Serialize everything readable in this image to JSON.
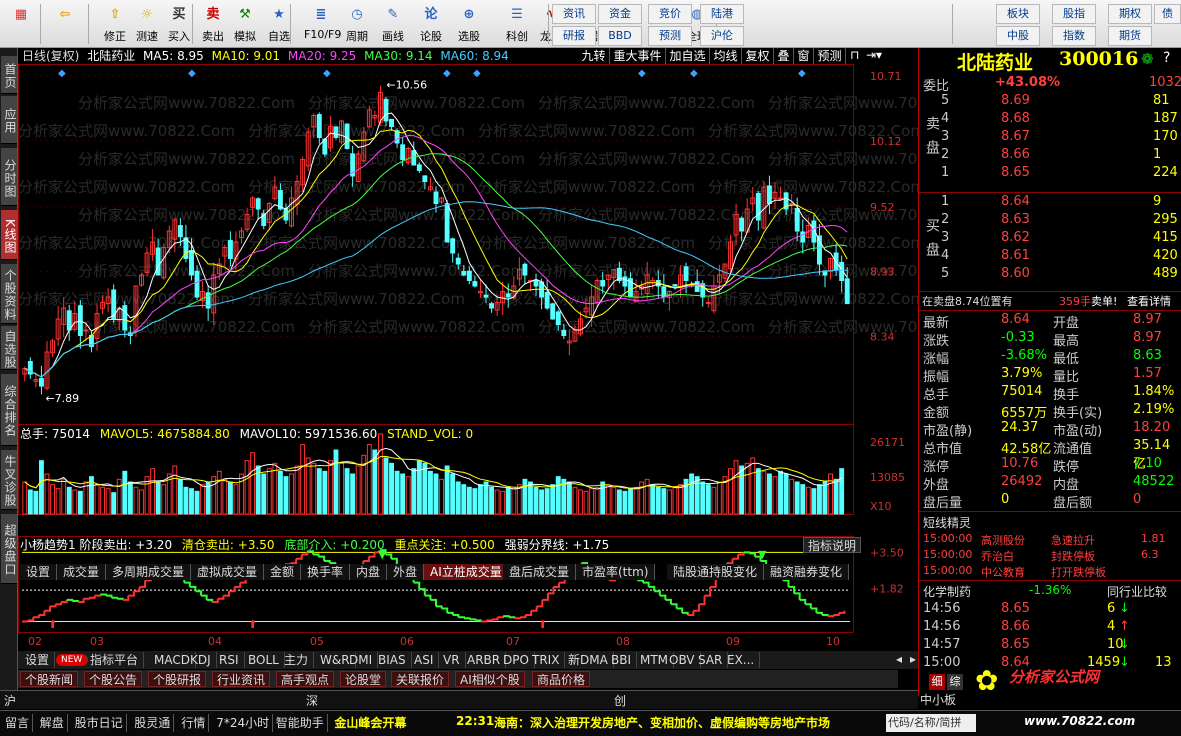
{
  "toolbar": {
    "buttons": [
      {
        "label": "",
        "icon": "grid-icon"
      },
      {
        "label": "",
        "icon": "back-arrow-icon"
      },
      {
        "label": "修正"
      },
      {
        "label": "测速"
      },
      {
        "label": "买入"
      },
      {
        "label": "卖出"
      },
      {
        "label": "模拟"
      },
      {
        "label": "自选"
      },
      {
        "label": "F10/F9"
      },
      {
        "label": "周期"
      },
      {
        "label": "画线"
      },
      {
        "label": "论股"
      },
      {
        "label": "选股"
      },
      {
        "label": "科创"
      },
      {
        "label": "龙虎"
      },
      {
        "label": "数据"
      },
      {
        "label": "热点"
      },
      {
        "label": "新闻"
      },
      {
        "label": "全球"
      }
    ],
    "small": [
      "资讯",
      "资金",
      "竞价",
      "陆港",
      "研报",
      "BBD",
      "预测",
      "沪伦",
      "板块",
      "股指",
      "期权",
      "债",
      "中股",
      "指数",
      "期货"
    ],
    "glyph_buy": "买",
    "glyph_sell": "卖",
    "glyph_clock": "⏰",
    "glyph_lun": "论",
    "glyph_pe": "PE",
    "glyph_hot": "🔥"
  },
  "sidebar": [
    "首页",
    "应用",
    "分时图",
    "K线图",
    "个股资料",
    "自选股",
    "综合排名",
    "牛叉诊股",
    "超级盘口"
  ],
  "chart": {
    "header": {
      "period": "日线(复权)",
      "name": "北陆药业",
      "ma5": "MA5: 8.95",
      "ma10": "MA10: 9.01",
      "ma20": "MA20: 9.25",
      "ma30": "MA30: 9.14",
      "ma60": "MA60: 8.94"
    },
    "topbtns": [
      "九转",
      "重大事件",
      "加自选",
      "均线",
      "复权",
      "叠",
      "窗",
      "预测"
    ],
    "price_ticks": [
      "10.71",
      "10.12",
      "9.52",
      "8.93",
      "8.34"
    ],
    "high_label": "10.56",
    "low_label": "7.89",
    "watermark": "分析家公式网www.70822.Com",
    "vol_header": {
      "total": "总手: 75014",
      "mavol5": "MAVOL5: 4675884.80",
      "mavol10": "MAVOL10: 5971536.60",
      "std": "STAND_VOL: 0"
    },
    "vol_ticks": [
      "26171",
      "13085",
      "X10"
    ],
    "vtabs": [
      "设置",
      "成交量",
      "多周期成交量",
      "虚拟成交量",
      "金额",
      "换手率",
      "内盘",
      "外盘",
      "AI立桩成交量",
      "盘后成交量",
      "市盈率(ttm)",
      "陆股通持股变化",
      "融资融券变化"
    ],
    "ind_header": {
      "t1": "小杨趋势1 阶段卖出: +3.20",
      "t2": "清仓卖出: +3.50",
      "t3": "底部介入: +0.200",
      "t4": "重点关注: +0.500",
      "t5": "强弱分界线: +1.75",
      "help": "指标说明"
    },
    "ind_ticks": [
      "+3.50",
      "+1.82"
    ],
    "months": [
      "02",
      "03",
      "04",
      "05",
      "06",
      "07",
      "08",
      "09",
      "10"
    ],
    "candles": {
      "closes": [
        8.05,
        8.0,
        7.95,
        7.89,
        8.2,
        8.3,
        8.5,
        8.6,
        8.4,
        8.55,
        8.35,
        8.4,
        8.25,
        8.55,
        8.65,
        8.7,
        8.5,
        8.6,
        8.4,
        8.35,
        8.8,
        8.9,
        9.1,
        9.2,
        8.9,
        9.15,
        9.3,
        9.4,
        9.25,
        9.05,
        8.9,
        8.7,
        8.75,
        8.6,
        8.9,
        9.0,
        9.15,
        9.05,
        9.2,
        9.3,
        9.45,
        9.6,
        9.5,
        9.35,
        9.55,
        9.7,
        9.5,
        9.4,
        9.6,
        9.75,
        9.95,
        10.2,
        10.35,
        10.15,
        10.0,
        10.25,
        10.15,
        10.3,
        10.05,
        9.8,
        10.0,
        10.2,
        10.4,
        10.35,
        10.56,
        10.3,
        10.25,
        10.1,
        9.95,
        10.05,
        9.9,
        9.85,
        9.75,
        9.7,
        9.55,
        9.6,
        9.2,
        9.1,
        9.0,
        8.9,
        8.85,
        8.8,
        8.75,
        8.7,
        8.6,
        8.65,
        8.75,
        8.7,
        8.8,
        8.95,
        8.9,
        8.85,
        8.8,
        8.7,
        8.6,
        8.5,
        8.45,
        8.35,
        8.3,
        8.4,
        8.5,
        8.6,
        8.7,
        8.85,
        8.8,
        8.9,
        8.95,
        8.85,
        8.8,
        8.7,
        8.75,
        8.8,
        8.9,
        8.85,
        8.8,
        8.7,
        8.75,
        8.8,
        8.9,
        8.85,
        8.8,
        8.75,
        8.7,
        8.65,
        8.8,
        8.9,
        9.0,
        9.2,
        9.45,
        9.3,
        9.5,
        9.6,
        9.4,
        9.7,
        9.55,
        9.65,
        9.6,
        9.5,
        9.55,
        9.3,
        9.2,
        9.35,
        9.2,
        9.0,
        8.9,
        9.05,
        8.95,
        8.85,
        8.64
      ],
      "range": [
        7.6,
        10.8
      ]
    },
    "volumes": [
      120,
      90,
      85,
      200,
      150,
      110,
      95,
      130,
      100,
      90,
      85,
      120,
      140,
      110,
      100,
      95,
      80,
      130,
      160,
      120,
      100,
      90,
      140,
      170,
      120,
      110,
      150,
      180,
      130,
      100,
      95,
      85,
      110,
      120,
      140,
      160,
      130,
      120,
      110,
      150,
      200,
      230,
      180,
      150,
      170,
      190,
      160,
      140,
      150,
      180,
      260,
      210,
      190,
      170,
      160,
      200,
      240,
      190,
      170,
      150,
      180,
      220,
      260,
      240,
      300,
      210,
      190,
      160,
      150,
      140,
      170,
      200,
      190,
      160,
      150,
      130,
      180,
      150,
      120,
      110,
      100,
      95,
      110,
      120,
      100,
      90,
      85,
      100,
      95,
      110,
      130,
      120,
      100,
      90,
      95,
      110,
      140,
      130,
      120,
      100,
      90,
      85,
      95,
      100,
      120,
      110,
      100,
      90,
      85,
      95,
      100,
      120,
      130,
      110,
      100,
      95,
      90,
      100,
      110,
      130,
      150,
      140,
      120,
      110,
      100,
      120,
      140,
      170,
      200,
      180,
      190,
      210,
      170,
      160,
      150,
      140,
      160,
      150,
      130,
      120,
      110,
      100,
      95,
      110,
      120,
      150,
      130,
      170
    ],
    "indicator": [
      0.3,
      0.35,
      0.5,
      0.6,
      0.8,
      1.0,
      1.1,
      1.2,
      1.3,
      1.25,
      1.2,
      1.35,
      1.4,
      1.5,
      1.55,
      1.5,
      1.4,
      1.35,
      1.3,
      1.5,
      1.7,
      1.9,
      2.2,
      2.5,
      2.6,
      2.7,
      2.65,
      2.5,
      2.3,
      2.1,
      1.9,
      1.7,
      1.5,
      1.3,
      1.2,
      1.35,
      1.5,
      1.7,
      1.9,
      2.1,
      2.3,
      2.5,
      2.6,
      2.55,
      2.7,
      2.85,
      2.9,
      2.95,
      3.0,
      3.2,
      3.4,
      3.55,
      3.4,
      3.3,
      3.1,
      3.0,
      2.9,
      2.7,
      2.5,
      2.6,
      2.8,
      3.1,
      3.3,
      3.5,
      3.6,
      3.4,
      3.2,
      2.9,
      2.6,
      2.4,
      2.1,
      1.8,
      1.5,
      1.3,
      1.0,
      0.9,
      0.7,
      0.6,
      0.5,
      0.45,
      0.4,
      0.35,
      0.3,
      0.35,
      0.4,
      0.5,
      0.55,
      0.5,
      0.45,
      0.5,
      0.6,
      0.8,
      1.0,
      1.3,
      1.6,
      1.9,
      2.1,
      2.4,
      2.6,
      2.8,
      3.0,
      2.9,
      2.7,
      2.5,
      2.3,
      2.2,
      2.4,
      2.6,
      2.5,
      2.3,
      2.2,
      2.1,
      1.9,
      1.7,
      1.5,
      1.3,
      1.1,
      0.9,
      0.7,
      0.6,
      0.8,
      1.1,
      1.5,
      1.9,
      2.3,
      2.7,
      3.0,
      3.2,
      3.4,
      3.5,
      3.45,
      3.3,
      3.1,
      2.9,
      2.7,
      2.5,
      2.2,
      1.9,
      1.6,
      1.3,
      1.1,
      0.9,
      0.7,
      0.6,
      0.55,
      0.6,
      0.7,
      0.8
    ]
  },
  "quote": {
    "name": "北陆药业",
    "code": "300016",
    "weibi_label": "委比",
    "weibi": "+43.08%",
    "weibi_vol": "1032",
    "sell": [
      [
        "5",
        "8.69",
        "81"
      ],
      [
        "4",
        "8.68",
        "187"
      ],
      [
        "3",
        "8.67",
        "170"
      ],
      [
        "2",
        "8.66",
        "1"
      ],
      [
        "1",
        "8.65",
        "224"
      ]
    ],
    "buy": [
      [
        "1",
        "8.64",
        "9"
      ],
      [
        "2",
        "8.63",
        "295"
      ],
      [
        "3",
        "8.62",
        "415"
      ],
      [
        "4",
        "8.61",
        "420"
      ],
      [
        "5",
        "8.60",
        "489"
      ]
    ],
    "sell_side": "卖盘",
    "buy_side": "买盘",
    "info": "在卖盘8.74位置有",
    "info_vol": "359手",
    "info_tag": "卖单!",
    "info_link": "查看详情",
    "stats": [
      [
        "最新",
        "8.64",
        "开盘",
        "8.97"
      ],
      [
        "涨跌",
        "-0.33",
        "最高",
        "8.97"
      ],
      [
        "涨幅",
        "-3.68%",
        "最低",
        "8.63"
      ],
      [
        "振幅",
        "3.79%",
        "量比",
        "1.57"
      ],
      [
        "总手",
        "75014",
        "换手",
        "1.84%"
      ],
      [
        "金额",
        "6557万",
        "换手(实)",
        "2.19%"
      ],
      [
        "市盈(静)",
        "24.37",
        "市盈(动)",
        "18.20"
      ],
      [
        "总市值",
        "42.58亿",
        "流通值",
        "35.14亿"
      ],
      [
        "涨停",
        "10.76",
        "跌停",
        "7.10"
      ],
      [
        "外盘",
        "26492",
        "内盘",
        "48522"
      ],
      [
        "盘后量",
        "0",
        "盘后额",
        "0"
      ]
    ],
    "elves_title": "短线精灵",
    "elves": [
      [
        "15:00:00",
        "高测股份",
        "急速拉升",
        "1.81"
      ],
      [
        "15:00:00",
        "乔治白",
        "封跌停板",
        "6.3"
      ],
      [
        "15:00:00",
        "中公教育",
        "打开跌停板",
        ""
      ]
    ],
    "industry_label": "化学制药",
    "industry_pct": "-1.36%",
    "industry_cmp": "同行业比较",
    "ticks": [
      [
        "14:56",
        "8.65",
        "6",
        "down"
      ],
      [
        "14:56",
        "8.66",
        "4",
        "up"
      ],
      [
        "14:57",
        "8.65",
        "10",
        "down"
      ],
      [
        "15:00",
        "8.64",
        "1459",
        "down"
      ]
    ],
    "tick_extra": "13",
    "tabs": [
      "细",
      "综"
    ]
  },
  "bottom_tabs": [
    "设置",
    "NEW",
    "指标平台",
    "MACD",
    "KDJ",
    "RSI",
    "BOLL",
    "主力",
    "W&R",
    "DMI",
    "BIAS",
    "ASI",
    "VR",
    "ARBR",
    "DPO",
    "TRIX",
    "新DMA",
    "BBI",
    "MTM",
    "OBV",
    "SAR",
    "EX..."
  ],
  "news_tabs": [
    "个股新闻",
    "个股公告",
    "个股研报",
    "行业资讯",
    "高手观点",
    "论股堂",
    "关联报价",
    "AI相似个股",
    "商品价格"
  ],
  "index_bar": [
    "沪",
    "深",
    "创"
  ],
  "status": {
    "buttons": [
      "留言",
      "解盘",
      "股市日记",
      "股灵通",
      "行情",
      "7*24小时",
      "智能助手"
    ],
    "summit": "金山峰会开幕",
    "ticker_time": "22:31",
    "ticker": "海南：深入治理开发房地产、变相加价、虚假编购等房地产市场",
    "input": "代码/名称/简拼",
    "mid": "中小板",
    "logo": "分析家公式网",
    "logo_url": "www.70822.com"
  }
}
